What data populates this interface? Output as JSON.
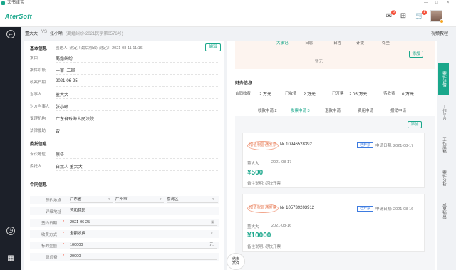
{
  "window": {
    "title": "文书律宝",
    "controls": [
      "—",
      "□",
      "×"
    ]
  },
  "header": {
    "brand": "AterSoft",
    "msg_badge": "6",
    "cart_badge": "1"
  },
  "breadcrumb": {
    "party_a": "董大大",
    "vs": "VS",
    "party_b": "张小晰",
    "case_no": "(离婚纠纷-2021民字第0576号)",
    "help": "视频教程"
  },
  "left": {
    "basic_title": "基本信息",
    "creator": "创建人: 测定川",
    "modifier": "最后修改: 测定川 2021-08-11 11:16",
    "edit": "编辑",
    "rows": [
      {
        "label": "案由",
        "value": "离婚纠纷"
      },
      {
        "label": "案件阶段",
        "value": "一审_二审"
      },
      {
        "label": "收案日期",
        "value": "2021-06-25"
      },
      {
        "label": "当事人",
        "value": "董大大"
      },
      {
        "label": "对方当事人",
        "value": "张小晰"
      },
      {
        "label": "受理机构",
        "value": "广东省珠海人民法院"
      },
      {
        "label": "法律援助",
        "value": "否"
      }
    ],
    "entrust_title": "委托信息",
    "entrust": [
      {
        "label": "诉讼地位",
        "value": "原告"
      },
      {
        "label": "委托人",
        "value": "自然人 董大大"
      }
    ],
    "contract_title": "合同信息",
    "form": {
      "sign_place_label": "签约地点",
      "province": "广东省",
      "city": "广州市",
      "district": "荔湾区",
      "addr_label": "详细地址",
      "addr": "芳和花园",
      "sign_date_label": "签约日期",
      "sign_date": "2021-06-25",
      "fee_mode_label": "收费方式",
      "fee_mode": "全额收费",
      "amount_label": "标的金额",
      "amount": "100000",
      "unit": "元",
      "lawyer_fee_label": "律师费",
      "lawyer_fee": "20000"
    }
  },
  "right": {
    "tabs_top": [
      "大事记",
      "日志",
      "日程",
      "计提",
      "保全"
    ],
    "add": "添加",
    "empty": "暂无",
    "fin_title": "财务信息",
    "stats": [
      {
        "label": "合同收费",
        "value": "2 万元"
      },
      {
        "label": "已收费",
        "value": "2 万元"
      },
      {
        "label": "已开票",
        "value": "2.05 万元"
      },
      {
        "label": "待收费",
        "value": "0 万元"
      }
    ],
    "fin_tabs": [
      "收款申请 2",
      "发票申请 3",
      "退款申请",
      "费用申请",
      "报销申请"
    ],
    "invoices": [
      {
        "stamp": "增值税普通发票",
        "no": "№ 10946528392",
        "status": "已开票",
        "date": "申请日期: 2021-08-17",
        "payer": "董大大",
        "pdate": "2021-08-17",
        "amount": "¥500",
        "note": "备注说明: 尽快开票"
      },
      {
        "stamp": "增值税普通发票",
        "no": "№ 105739203912",
        "status": "已开票",
        "date": "申请日期: 2021-08-16",
        "payer": "董大大",
        "pdate": "2021-08-16",
        "amount": "¥10000",
        "note": "备注说明: 尽快开票"
      }
    ],
    "end_case": [
      "结束",
      "案件"
    ]
  },
  "vtabs": [
    "案件详情",
    "工作平台",
    "工作底稿",
    "案件分析",
    "成果输出"
  ]
}
